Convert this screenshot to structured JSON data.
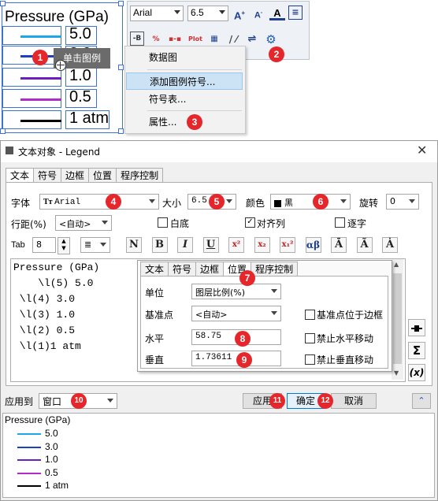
{
  "legend_top": {
    "title": "Pressure (GPa)",
    "items": [
      {
        "color": "#1ea7e6",
        "value": "5.0"
      },
      {
        "color": "#1c3fbf",
        "value": "3.0"
      },
      {
        "color": "#6a1fc2",
        "value": "1.0"
      },
      {
        "color": "#b02cc6",
        "value": "0.5"
      },
      {
        "color": "#000000",
        "value": "1 atm"
      }
    ]
  },
  "tooltip": "单击图例",
  "toolbar": {
    "font": "Arial",
    "size": "6.5"
  },
  "context_menu": {
    "items": [
      "数据图",
      "添加图例符号...",
      "符号表...",
      "属性..."
    ]
  },
  "dialog": {
    "title": "文本对象 - Legend",
    "tabs": [
      "文本",
      "符号",
      "边框",
      "位置",
      "程序控制"
    ],
    "font_label": "字体",
    "font_value": "Arial",
    "size_label": "大小",
    "size_value": "6.5",
    "color_label": "颜色",
    "color_value": "黑",
    "rotate_label": "旋转",
    "rotate_value": "0",
    "linespacing_label": "行距(%)",
    "linespacing_value": "<自动>",
    "white_out_label": "白底",
    "align_label": "对齐列",
    "char_by_char_label": "逐字",
    "tab_label": "Tab",
    "tab_value": "8",
    "format_buttons": [
      "N",
      "B",
      "I",
      "U",
      "x²",
      "x₂",
      "x₁²",
      "αβ",
      "Ā",
      "Ã",
      "Ȧ"
    ],
    "text_lines": [
      "Pressure (GPa)",
      "    \\l(5) 5.0",
      " \\l(4) 3.0",
      " \\l(3) 1.0",
      " \\l(2) 0.5",
      " \\l(1)1 atm"
    ],
    "side_buttons": [
      "Σ",
      "(x)"
    ],
    "apply_to_label": "应用到",
    "apply_to_value": "窗口",
    "apply_button": "应用",
    "ok_button": "确定",
    "cancel_button": "取消",
    "inner": {
      "tabs": [
        "文本",
        "符号",
        "边框",
        "位置",
        "程序控制"
      ],
      "unit_label": "单位",
      "unit_value": "图层比例(%)",
      "anchor_label": "基准点",
      "anchor_value": "<自动>",
      "anchor_on_border_label": "基准点位于边框",
      "horizontal_label": "水平",
      "horizontal_value": "58.75",
      "vertical_label": "垂直",
      "vertical_value": "1.73611",
      "lock_h_label": "禁止水平移动",
      "lock_v_label": "禁止垂直移动"
    }
  },
  "preview": {
    "title": "Pressure (GPa)",
    "items": [
      {
        "color": "#1ea7e6",
        "value": "5.0"
      },
      {
        "color": "#1c3fbf",
        "value": "3.0"
      },
      {
        "color": "#6a1fc2",
        "value": "1.0"
      },
      {
        "color": "#b02cc6",
        "value": "0.5"
      },
      {
        "color": "#000000",
        "value": "1 atm"
      }
    ]
  },
  "badges": [
    "1",
    "2",
    "3",
    "4",
    "5",
    "6",
    "7",
    "8",
    "9",
    "10",
    "11",
    "12"
  ]
}
